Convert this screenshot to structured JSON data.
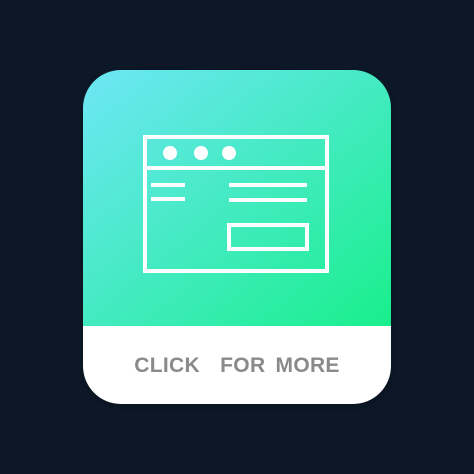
{
  "colors": {
    "background": "#0c1827",
    "gradient_start": "#6ee6f6",
    "gradient_end": "#19ef8c",
    "icon_stroke": "#ffffff",
    "button_bg": "#ffffff",
    "button_text": "#8a8a8a"
  },
  "icon": {
    "name": "browser-window-icon"
  },
  "button": {
    "label": "CLICK  FOR MORE"
  }
}
